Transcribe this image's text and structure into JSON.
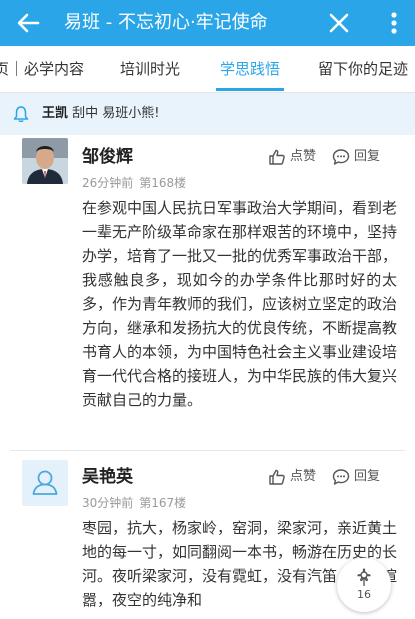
{
  "appbar": {
    "title": "易班 - 不忘初心·牢记使命"
  },
  "tabs": [
    {
      "label": "页｜必学内容"
    },
    {
      "label": "培训时光"
    },
    {
      "label": "学思践悟"
    },
    {
      "label": "留下你的足迹"
    }
  ],
  "notice": {
    "name": "王凯",
    "text": "刮中 易班小熊!"
  },
  "comments": [
    {
      "name": "邹俊辉",
      "time": "26分钟前",
      "floor": "第168楼",
      "like_label": "点赞",
      "reply_label": "回复",
      "body": "在参观中国人民抗日军事政治大学期间，看到老一辈无产阶级革命家在那样艰苦的环境中，坚持办学，培育了一批又一批的优秀军事政治干部，我感触良多，现如今的办学条件比那时好的太多，作为青年教师的我们，应该树立坚定的政治方向，继承和发扬抗大的优良传统，不断提高教书育人的本领，为中国特色社会主义事业建设培育一代代合格的接班人，为中华民族的伟大复兴贡献自己的力量。"
    },
    {
      "name": "吴艳英",
      "time": "30分钟前",
      "floor": "第167楼",
      "like_label": "点赞",
      "reply_label": "回复",
      "body": "枣园，抗大，杨家岭，窑洞，梁家河，亲近黄土地的每一寸，如同翻阅一本书，畅游在历史的长河。夜听梁家河，没有霓虹，没有汽笛，没有喧嚣，夜空的纯净和"
    }
  ],
  "fab": {
    "count": "16"
  },
  "colors": {
    "accent": "#2aa6e8",
    "notice_bg": "#e9f3fb"
  }
}
